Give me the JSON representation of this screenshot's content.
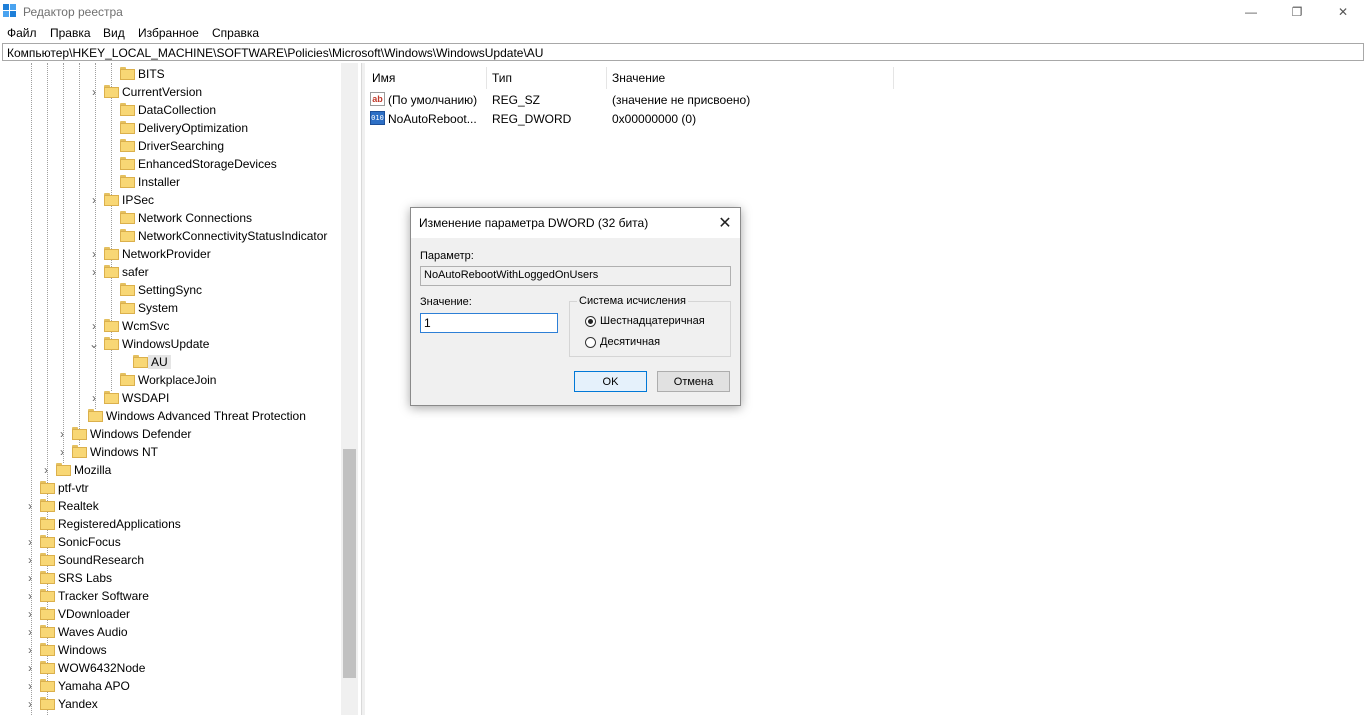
{
  "window": {
    "title": "Редактор реестра",
    "minimize_glyph": "—",
    "restore_glyph": "❐",
    "close_glyph": "✕",
    "app_icon": "registry-editor-icon"
  },
  "menu": [
    "Файл",
    "Правка",
    "Вид",
    "Избранное",
    "Справка"
  ],
  "address": "Компьютер\\HKEY_LOCAL_MACHINE\\SOFTWARE\\Policies\\Microsoft\\Windows\\WindowsUpdate\\AU",
  "tree": {
    "nodes": [
      {
        "label": "BITS",
        "expander": ""
      },
      {
        "label": "CurrentVersion",
        "expander": "›"
      },
      {
        "label": "DataCollection",
        "expander": ""
      },
      {
        "label": "DeliveryOptimization",
        "expander": ""
      },
      {
        "label": "DriverSearching",
        "expander": ""
      },
      {
        "label": "EnhancedStorageDevices",
        "expander": ""
      },
      {
        "label": "Installer",
        "expander": ""
      },
      {
        "label": "IPSec",
        "expander": "›"
      },
      {
        "label": "Network Connections",
        "expander": ""
      },
      {
        "label": "NetworkConnectivityStatusIndicator",
        "expander": ""
      },
      {
        "label": "NetworkProvider",
        "expander": "›"
      },
      {
        "label": "safer",
        "expander": "›"
      },
      {
        "label": "SettingSync",
        "expander": ""
      },
      {
        "label": "System",
        "expander": ""
      },
      {
        "label": "WcmSvc",
        "expander": "›"
      },
      {
        "label": "WindowsUpdate",
        "expander": "⌄"
      },
      {
        "label": "AU",
        "expander": ""
      },
      {
        "label": "WorkplaceJoin",
        "expander": ""
      },
      {
        "label": "WSDAPI",
        "expander": "›"
      },
      {
        "label": "Windows Advanced Threat Protection",
        "expander": ""
      },
      {
        "label": "Windows Defender",
        "expander": "›"
      },
      {
        "label": "Windows NT",
        "expander": "›"
      },
      {
        "label": "Mozilla",
        "expander": "›"
      },
      {
        "label": "ptf-vtr",
        "expander": ""
      },
      {
        "label": "Realtek",
        "expander": "›"
      },
      {
        "label": "RegisteredApplications",
        "expander": ""
      },
      {
        "label": "SonicFocus",
        "expander": "›"
      },
      {
        "label": "SoundResearch",
        "expander": "›"
      },
      {
        "label": "SRS Labs",
        "expander": "›"
      },
      {
        "label": "Tracker Software",
        "expander": "›"
      },
      {
        "label": "VDownloader",
        "expander": "›"
      },
      {
        "label": "Waves Audio",
        "expander": "›"
      },
      {
        "label": "Windows",
        "expander": "›"
      },
      {
        "label": "WOW6432Node",
        "expander": "›"
      },
      {
        "label": "Yamaha APO",
        "expander": "›"
      },
      {
        "label": "Yandex",
        "expander": "›"
      }
    ]
  },
  "list": {
    "columns": [
      "Имя",
      "Тип",
      "Значение"
    ],
    "rows": [
      {
        "icon": "string-value-icon",
        "icon_text": "ab",
        "name": "(По умолчанию)",
        "type": "REG_SZ",
        "value": "(значение не присвоено)"
      },
      {
        "icon": "dword-value-icon",
        "icon_text": "010",
        "name": "NoAutoReboot...",
        "type": "REG_DWORD",
        "value": "0x00000000 (0)"
      }
    ]
  },
  "dialog": {
    "title": "Изменение параметра DWORD (32 бита)",
    "close_glyph": "✕",
    "name_label": "Параметр:",
    "name_value": "NoAutoRebootWithLoggedOnUsers",
    "value_label": "Значение:",
    "value": "1",
    "base_group_label": "Система исчисления",
    "hex_label": "Шестнадцатеричная",
    "dec_label": "Десятичная",
    "base_selected": "hex",
    "ok_label": "OK",
    "cancel_label": "Отмена"
  }
}
